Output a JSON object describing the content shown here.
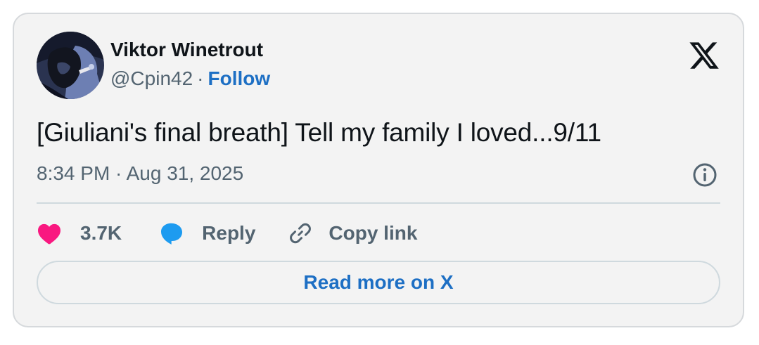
{
  "author": {
    "display_name": "Viktor Winetrout",
    "handle": "@Cpin42",
    "separator": "·",
    "follow_label": "Follow"
  },
  "tweet": {
    "text": "[Giuliani's final breath] Tell my family I loved...9/11",
    "timestamp": "8:34 PM · Aug 31, 2025"
  },
  "actions": {
    "like_count": "3.7K",
    "reply_label": "Reply",
    "copy_link_label": "Copy link"
  },
  "read_more_label": "Read more on X",
  "icons": {
    "brand": "x-logo-icon",
    "info": "info-icon",
    "like": "heart-icon",
    "reply": "speech-bubble-icon",
    "copy": "link-icon"
  },
  "colors": {
    "like": "#f91880",
    "reply": "#1d9bf0",
    "link_accent": "#1d6fc4",
    "muted_text": "#536471",
    "card_background": "#f3f3f3"
  }
}
